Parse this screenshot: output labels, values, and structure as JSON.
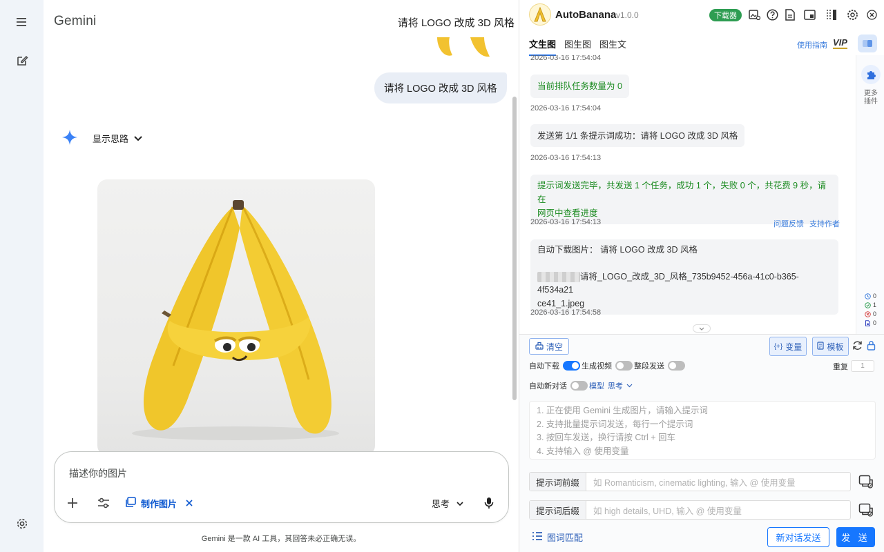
{
  "gemini": {
    "brand": "Gemini",
    "conversation_title": "请将 LOGO 改成 3D 风格",
    "user_message": "请将 LOGO 改成 3D 风格",
    "thinking_toggle": "显示思路",
    "composer": {
      "placeholder": "描述你的图片",
      "make_image_chip": "制作图片",
      "mode": "思考"
    },
    "disclaimer": "Gemini 是一款 AI 工具，其回答未必正确无误。"
  },
  "ext": {
    "name": "AutoBanana",
    "version": "v1.0.0",
    "downloader_badge": "下载器",
    "tabs": [
      "文生图",
      "图生图",
      "图生文"
    ],
    "active_tab": 0,
    "guide_link": "使用指南",
    "vip": "VIP",
    "more_plugins": "更多插件",
    "stats": [
      {
        "icon": "clock-icon",
        "value": "0"
      },
      {
        "icon": "check-circle-icon",
        "value": "1"
      },
      {
        "icon": "error-circle-icon",
        "value": "0"
      },
      {
        "icon": "document-icon",
        "value": "0"
      }
    ],
    "log": {
      "ts0": "2026-03-16 17:54:04",
      "m1": "当前排队任务数量为 0",
      "ts1": "2026-03-16 17:54:04",
      "m2": "发送第 1/1 条提示词成功：请将 LOGO 改成 3D 风格",
      "ts2": "2026-03-16 17:54:13",
      "m3_line1": "提示词发送完毕，共发送 1 个任务，成功 1 个，失败 0 个，共花费 9 秒，请在",
      "m3_line2": "网页中查看进度",
      "ts3": "2026-03-16 17:54:13",
      "feedback": "问题反馈",
      "support": "支持作者",
      "m4_title": "自动下载图片： 请将 LOGO 改成 3D 风格",
      "m4_file_line1": "请将_LOGO_改成_3D_风格_735b9452-456a-41c0-b365-4f534a21",
      "m4_file_line2": "ce41_1.jpeg",
      "ts4": "2026-03-16 17:54:58"
    },
    "controls": {
      "clear": "清空",
      "variable": "变量",
      "template": "模板",
      "auto_download": "自动下载",
      "gen_video": "生成视频",
      "segment_send": "整段发送",
      "repeat_label": "重复",
      "repeat_value": "1",
      "auto_new_chat": "自动新对话",
      "model_label": "模型",
      "model_value": "思考",
      "prompt_placeholder": [
        "1. 正在使用 Gemini 生成图片，请输入提示词",
        "2. 支持批量提示词发送，每行一个提示词",
        "3. 按回车发送，换行请按 Ctrl + 回车",
        "4. 支持输入 @ 使用变量"
      ],
      "prefix_label": "提示词前缀",
      "prefix_placeholder": "如 Romanticism, cinematic lighting, 输入 @ 使用变量",
      "suffix_label": "提示词后缀",
      "suffix_placeholder": "如 high details, UHD, 输入 @ 使用变量",
      "match": "图词匹配",
      "new_chat_send": "新对话发送",
      "send": "发 送"
    },
    "colors": {
      "accent": "#1677ff",
      "success": "#2e9d52"
    }
  }
}
